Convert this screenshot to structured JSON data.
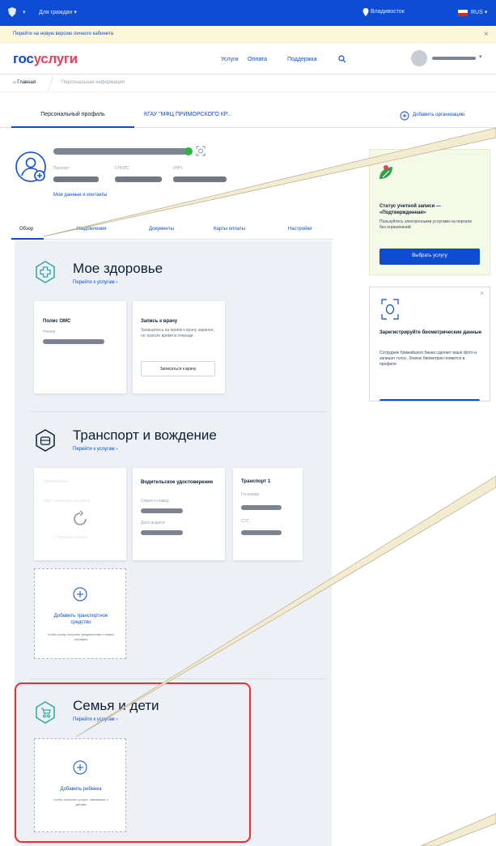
{
  "topbar": {
    "for_citizens": "Для граждан",
    "city": "Владивосток",
    "lang": "RUS"
  },
  "notice": {
    "text": "Перейти на новую версию личного кабинета",
    "close": "×"
  },
  "header": {
    "brand_part1": "гос",
    "brand_part2": "услуги",
    "nav": [
      "Услуги",
      "Оплата",
      "Поддержка"
    ]
  },
  "breadcrumbs": {
    "home": "Главная",
    "current": "Персональная информация"
  },
  "org_tabs": {
    "personal": "Персональный профиль",
    "org": "КГАУ \"МФЦ ПРИМОРСКОГО КР...",
    "add_org": "Добавить организацию"
  },
  "profile": {
    "fields": [
      "Паспорт",
      "СНИЛС",
      "ИНН"
    ],
    "data_link": "Мои данные и контакты"
  },
  "tabs": [
    "Обзор",
    "Уведомления",
    "Документы",
    "Карты оплаты",
    "Настройки"
  ],
  "health": {
    "title": "Мое здоровье",
    "link": "Перейти к услугам ›",
    "oms_card": {
      "title": "Полис ОМС",
      "label": "Номер"
    },
    "doctor_card": {
      "title": "Запись к врачу",
      "text": "Запишитесь на приём к врачу заранее, не тратьте время в очереди",
      "button": "Записаться к врачу"
    }
  },
  "transport": {
    "title": "Транспорт и вождение",
    "link": "Перейти к услугам ›",
    "fines_card": {
      "title": "Автоштрафы",
      "line1": "Идёт проверка штрафов",
      "line2": "Проверьте позже"
    },
    "license_card": {
      "title": "Водительское удостоверение",
      "label1": "Серия и номер",
      "label2": "Дата выдачи"
    },
    "vehicle_card": {
      "title": "Транспорт 1",
      "label1": "Госномер",
      "label2": "СТС"
    },
    "add_vehicle": {
      "title": "Добавить транспортное средство",
      "sub": "чтобы сразу получать уведомления о новых штрафах"
    }
  },
  "family": {
    "title": "Семья и дети",
    "link": "Перейти к услугам ›",
    "add_child": {
      "title": "Добавить ребенка",
      "sub": "чтобы получать услуги, связанные с детьми"
    }
  },
  "side_status": {
    "title": "Статус учетной записи — «Подтвержденная»",
    "text": "Пользуйтесь электронными услугами на портале без ограничений",
    "button": "Выбрать услугу"
  },
  "side_bio": {
    "title": "Зарегистрируйте биометрические данные",
    "text": "Сотрудник ближайшего банка сделает ваше фото и запишет голос. Значок биометрии появится в профиле",
    "close": "×"
  },
  "colors": {
    "primary": "#0d4cd3",
    "highlight": "#e8302e",
    "accent_red": "#ee3f58",
    "teal": "#2fa6a6"
  }
}
